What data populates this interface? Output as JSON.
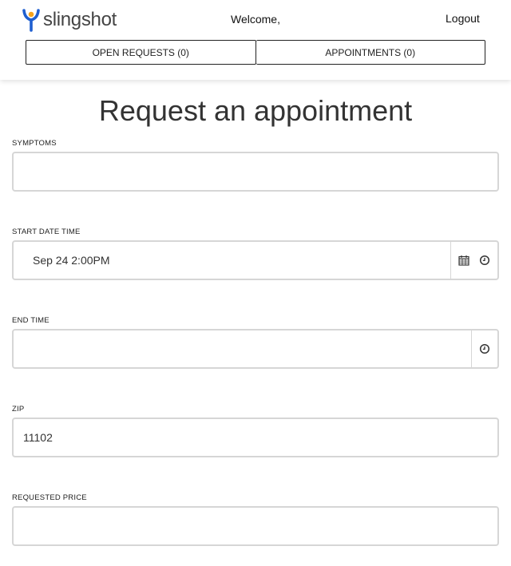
{
  "header": {
    "logo_text": "slingshot",
    "welcome": "Welcome,",
    "logout": "Logout",
    "tabs": [
      {
        "label": "OPEN REQUESTS (0)"
      },
      {
        "label": "APPOINTMENTS (0)"
      }
    ]
  },
  "page": {
    "title": "Request an appointment"
  },
  "form": {
    "symptoms": {
      "label": "SYMPTOMS",
      "value": "",
      "placeholder": ""
    },
    "start": {
      "label": "START DATE TIME",
      "value": "Sep 24 2:00PM",
      "icons": [
        "calendar-icon",
        "clock-icon"
      ]
    },
    "end": {
      "label": "END TIME",
      "value": "",
      "icons": [
        "clock-icon"
      ]
    },
    "zip": {
      "label": "ZIP",
      "value": "11102"
    },
    "price": {
      "label": "REQUESTED PRICE",
      "value": ""
    }
  },
  "colors": {
    "logo_blue": "#1f5fd0",
    "logo_orange": "#f5a21b",
    "field_border": "#d6d6d6"
  }
}
